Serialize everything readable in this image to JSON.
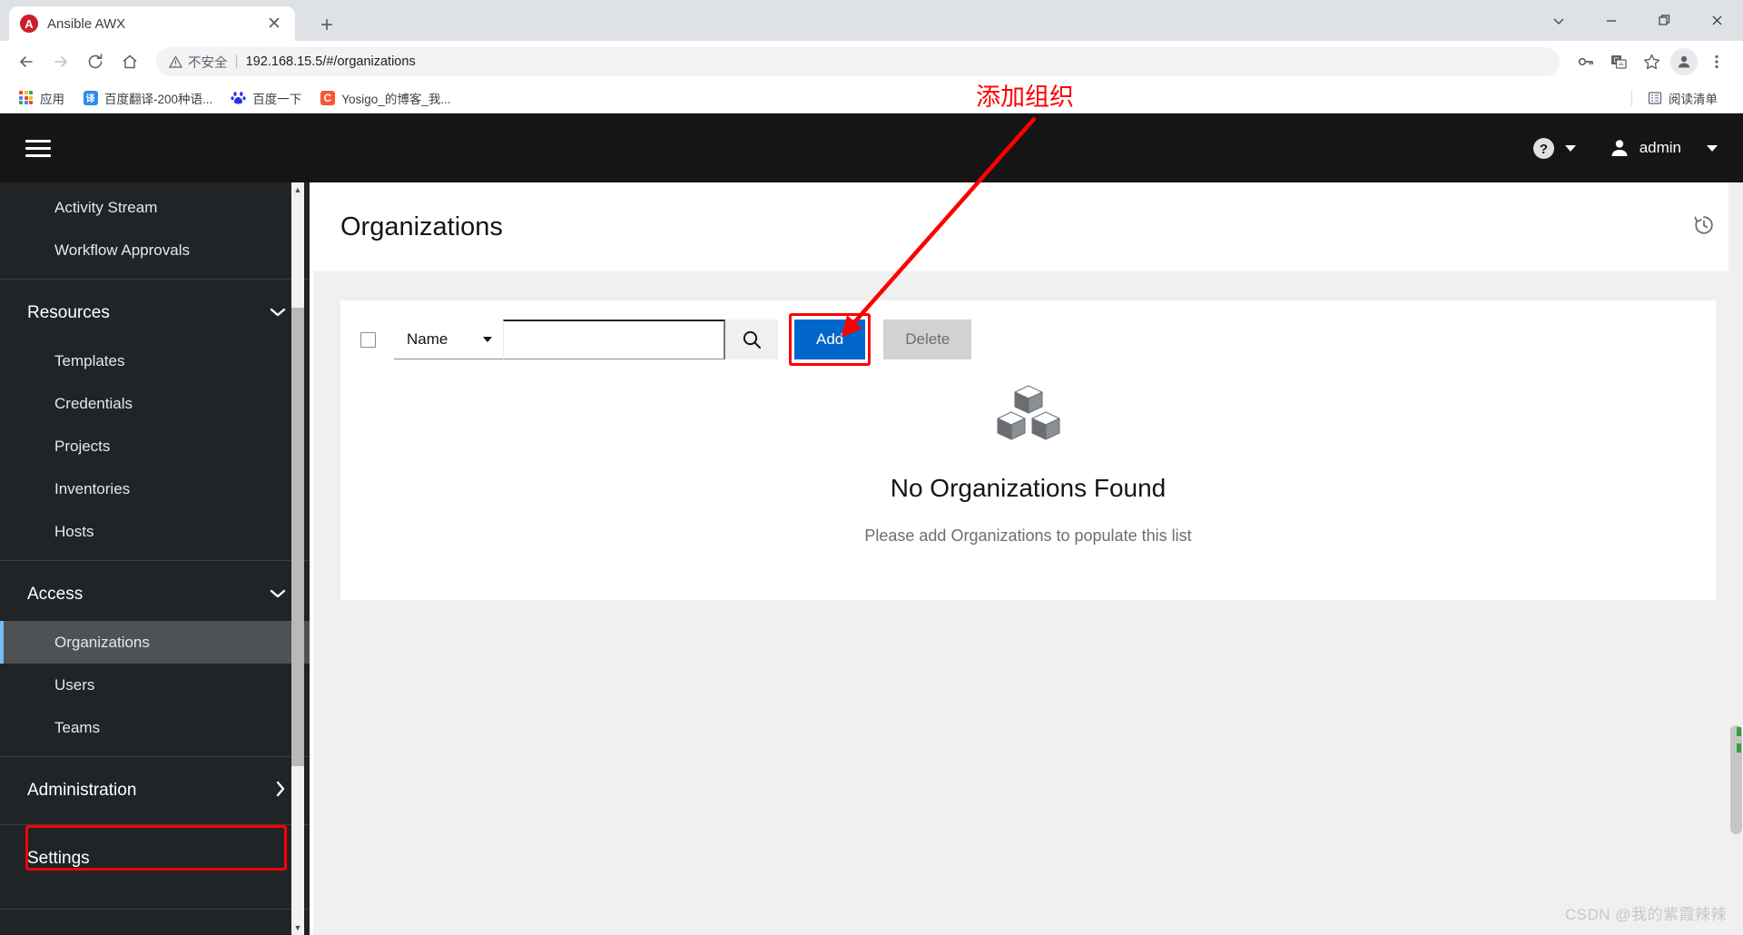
{
  "browser": {
    "tab": {
      "favicon_letter": "A",
      "favicon_icon": "ansible-logo-icon",
      "title": "Ansible AWX",
      "close_icon": "close-icon"
    },
    "new_tab_icon": "plus-icon",
    "window_controls": [
      {
        "name": "tab-search-button",
        "icon": "chevron-down-icon"
      },
      {
        "name": "minimize-button",
        "icon": "minimize-icon"
      },
      {
        "name": "maximize-button",
        "icon": "restore-icon"
      },
      {
        "name": "close-window-button",
        "icon": "close-icon"
      }
    ],
    "nav_icons": [
      {
        "name": "back-button",
        "icon": "arrow-left-icon"
      },
      {
        "name": "forward-button",
        "icon": "arrow-right-icon"
      },
      {
        "name": "reload-button",
        "icon": "reload-icon"
      },
      {
        "name": "home-button",
        "icon": "home-icon"
      }
    ],
    "omnibox": {
      "security_warning": "不安全",
      "security_icon": "warning-triangle-icon",
      "separator": "|",
      "url": "192.168.15.5/#/organizations"
    },
    "toolbar_right": [
      {
        "name": "password-manager-icon",
        "icon": "key-icon"
      },
      {
        "name": "translate-icon",
        "icon": "translate-icon"
      },
      {
        "name": "bookmark-star-icon",
        "icon": "star-icon"
      },
      {
        "name": "profile-avatar-icon",
        "icon": "person-icon"
      },
      {
        "name": "chrome-menu-icon",
        "icon": "kebab-menu-icon"
      }
    ],
    "bookmarks": [
      {
        "label": "应用",
        "icon": "apps-grid-icon",
        "color": "#4285f4"
      },
      {
        "label": "百度翻译-200种语...",
        "icon": "baidu-translate-icon",
        "color": "#2d8cf0",
        "glyph": "译"
      },
      {
        "label": "百度一下",
        "icon": "baidu-paw-icon",
        "color": "#2932e1",
        "glyph": ""
      },
      {
        "label": "Yosigo_的博客_我...",
        "icon": "csdn-icon",
        "color": "#fc5531",
        "glyph": "C"
      }
    ],
    "reading_list": {
      "label": "阅读清单",
      "icon": "reading-list-icon"
    }
  },
  "annotation": {
    "text": "添加组织",
    "color": "#ff0000"
  },
  "awx": {
    "header": {
      "menu_icon": "hamburger-menu-icon",
      "help_icon": "help-circle-icon",
      "help_caret_icon": "caret-down-icon",
      "user_icon": "user-avatar-icon",
      "username": "admin",
      "user_caret_icon": "caret-down-icon"
    },
    "sidebar": {
      "items": [
        {
          "label": "Activity Stream",
          "type": "item",
          "active": false
        },
        {
          "label": "Workflow Approvals",
          "type": "item",
          "active": false
        },
        {
          "label": "Resources",
          "type": "group",
          "expanded": true,
          "chevron": "chevron-down-icon"
        },
        {
          "label": "Templates",
          "type": "item",
          "active": false
        },
        {
          "label": "Credentials",
          "type": "item",
          "active": false
        },
        {
          "label": "Projects",
          "type": "item",
          "active": false
        },
        {
          "label": "Inventories",
          "type": "item",
          "active": false
        },
        {
          "label": "Hosts",
          "type": "item",
          "active": false
        },
        {
          "label": "Access",
          "type": "group",
          "expanded": true,
          "chevron": "chevron-down-icon"
        },
        {
          "label": "Organizations",
          "type": "item",
          "active": true
        },
        {
          "label": "Users",
          "type": "item",
          "active": false
        },
        {
          "label": "Teams",
          "type": "item",
          "active": false
        },
        {
          "label": "Administration",
          "type": "group",
          "expanded": false,
          "chevron": "chevron-right-icon"
        },
        {
          "label": "Settings",
          "type": "group-plain",
          "expanded": false,
          "chevron": ""
        }
      ]
    },
    "page": {
      "title": "Organizations",
      "history_icon": "history-clock-icon"
    },
    "toolbar": {
      "select_all_checkbox": "",
      "filter_label": "Name",
      "filter_caret_icon": "caret-down-icon",
      "search_value": "",
      "search_placeholder": "",
      "search_icon": "magnifier-icon",
      "add_label": "Add",
      "delete_label": "Delete",
      "add_color": "#0066cc"
    },
    "empty_state": {
      "icon": "cubes-icon",
      "title": "No Organizations Found",
      "subtitle": "Please add Organizations to populate this list"
    }
  },
  "watermark": {
    "text": "CSDN @我的紫霞辣辣"
  }
}
